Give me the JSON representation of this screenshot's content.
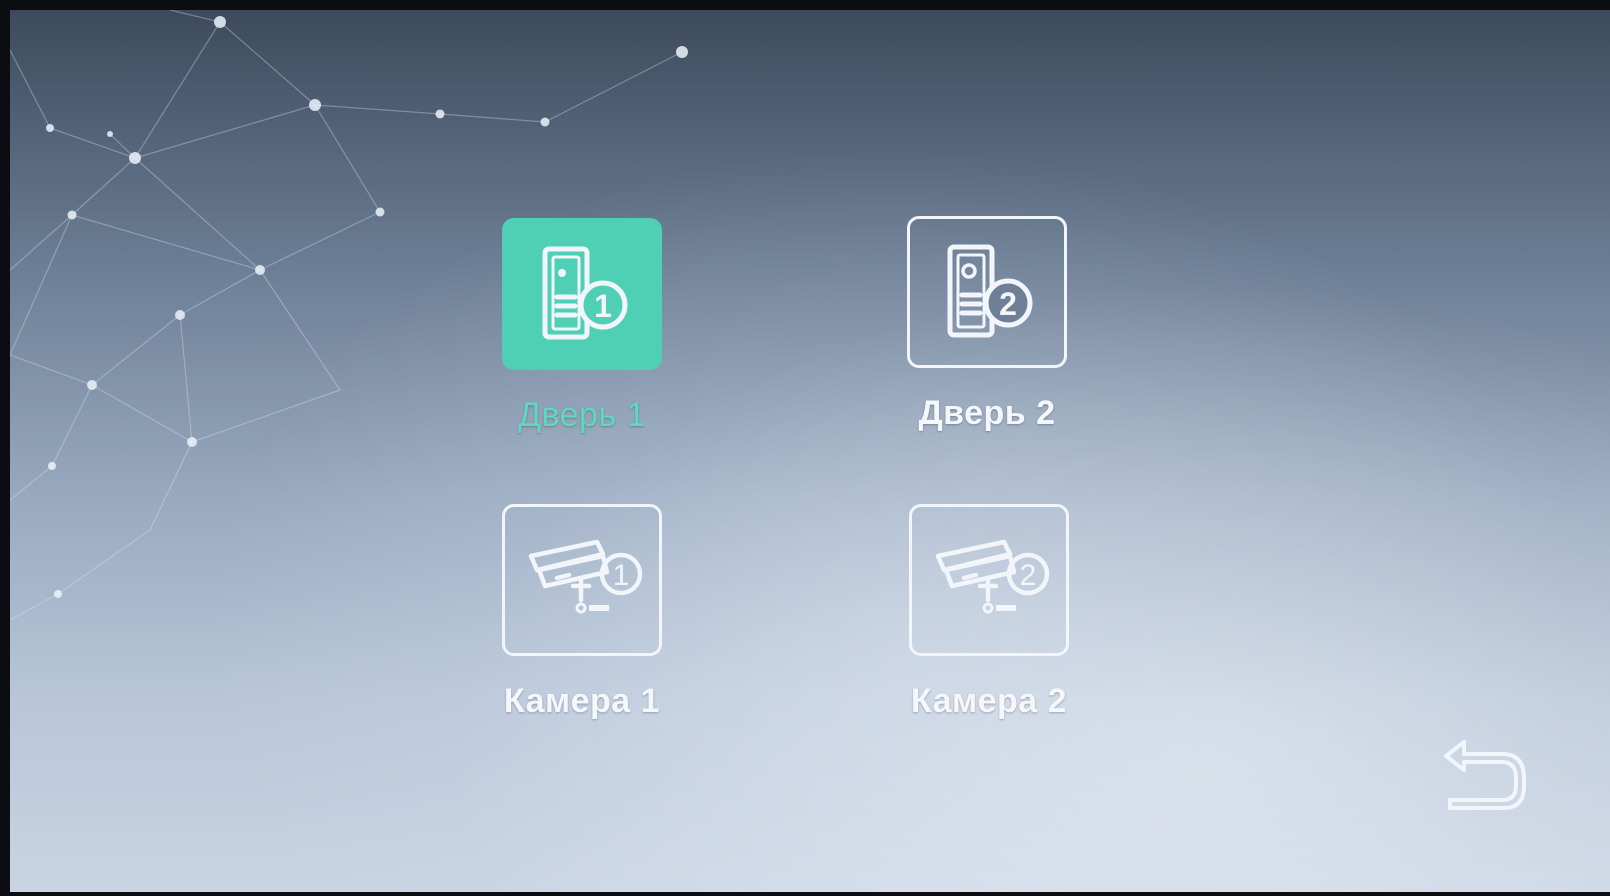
{
  "menu": {
    "items": [
      {
        "label": "Дверь 1",
        "icon": "door-panel-1-icon",
        "selected": true
      },
      {
        "label": "Дверь 2",
        "icon": "door-panel-2-icon",
        "selected": false
      },
      {
        "label": "Камера 1",
        "icon": "camera-1-icon",
        "selected": false
      },
      {
        "label": "Камера 2",
        "icon": "camera-2-icon",
        "selected": false
      }
    ]
  },
  "badges": {
    "one": "1",
    "two": "2"
  },
  "back_button": {
    "icon": "back-arrow-icon"
  },
  "colors": {
    "accent": "#4fd0b4",
    "accent_text": "#5fd8c1",
    "icon_stroke": "#f2f5fa"
  }
}
